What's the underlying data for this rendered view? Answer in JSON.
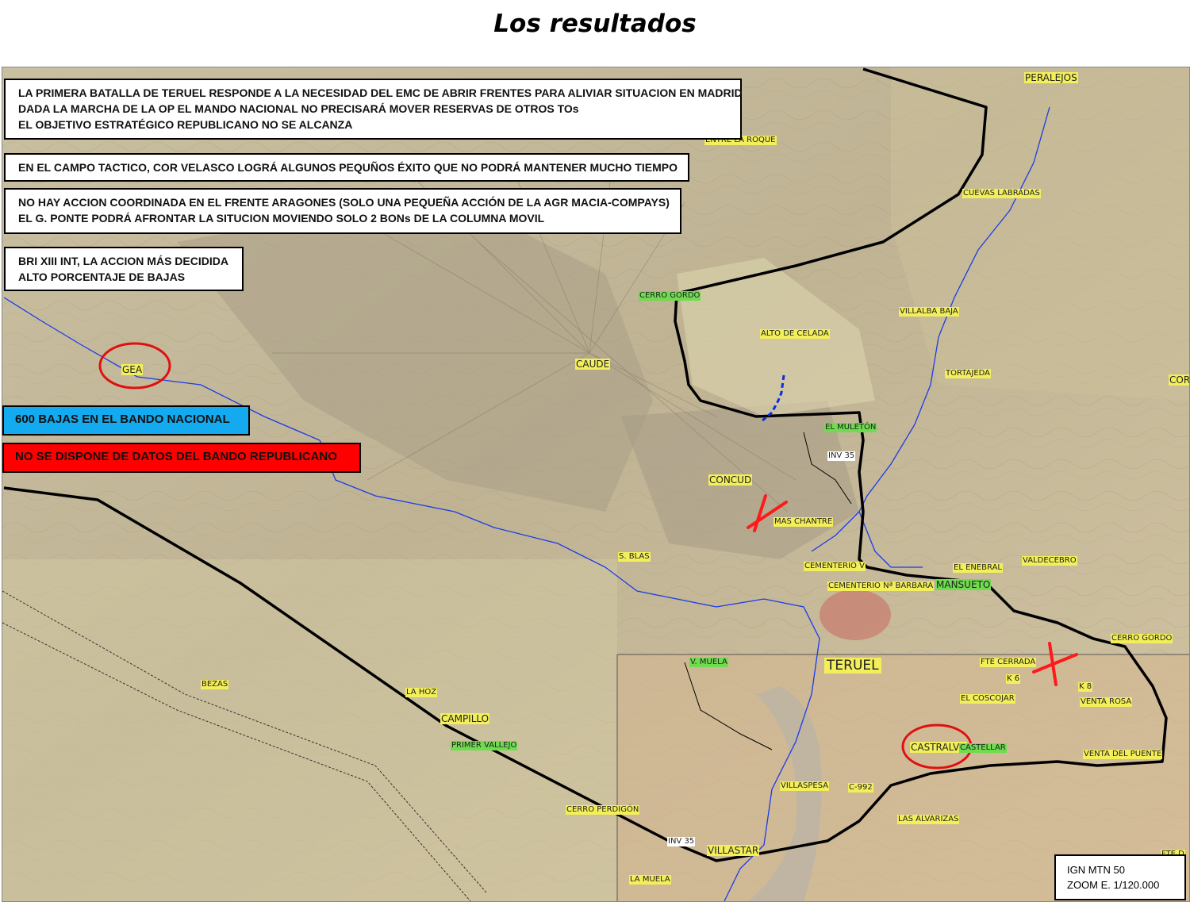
{
  "title": "Los resultados",
  "colors": {
    "nationalist_box": "#14aaf0",
    "republican_box": "#ff0000",
    "front_line": "#000000",
    "river": "#1a3ce8",
    "marker_x": "#ff1a1a",
    "circle": "#e01010",
    "label_yellow": "#f3ef5a",
    "label_green": "#6fdc4f"
  },
  "info_boxes": [
    {
      "lines": [
        "LA PRIMERA BATALLA DE TERUEL RESPONDE A LA NECESIDAD DEL EMC DE ABRIR FRENTES PARA ALIVIAR SITUACION EN MADRID",
        "DADA LA MARCHA DE LA OP EL MANDO NACIONAL NO PRECISARÁ MOVER RESERVAS DE OTROS TOs",
        "EL OBJETIVO ESTRATÉGICO REPUBLICANO NO SE ALCANZA"
      ]
    },
    {
      "lines": [
        "EN EL CAMPO TACTICO, COR VELASCO LOGRÁ ALGUNOS  PEQUÑOS ÉXITO QUE NO PODRÁ MANTENER MUCHO TIEMPO"
      ]
    },
    {
      "lines": [
        "NO HAY ACCION COORDINADA EN EL FRENTE ARAGONES (SOLO UNA PEQUEÑA ACCIÓN DE LA AGR MACIA-COMPAYS)",
        "EL G. PONTE PODRÁ AFRONTAR LA SITUCION MOVIENDO SOLO 2 BONs DE LA COLUMNA MOVIL"
      ]
    },
    {
      "lines": [
        "BRI XIII INT, LA ACCION MÁS DECIDIDA",
        "ALTO PORCENTAJE DE BAJAS"
      ]
    }
  ],
  "casualties": {
    "nationalist": "600 BAJAS EN EL BANDO NACIONAL",
    "republican": "NO SE DISPONE DE DATOS DEL BANDO REPUBLICANO"
  },
  "scale": {
    "source": "IGN MTN 50",
    "zoom": "ZOOM E. 1/120.000"
  },
  "places": [
    {
      "name": "PERALEJOS",
      "style": "yellow big"
    },
    {
      "name": "ENTRE LA ROQUE",
      "style": "yellow"
    },
    {
      "name": "CUEVAS LABRADAS",
      "style": "yellow"
    },
    {
      "name": "CERRO GORDO",
      "style": "green"
    },
    {
      "name": "VILLALBA BAJA",
      "style": "yellow"
    },
    {
      "name": "ALTO DE CELADA",
      "style": "yellow"
    },
    {
      "name": "TORTAJEDA",
      "style": "yellow"
    },
    {
      "name": "GEA",
      "style": "yellow big"
    },
    {
      "name": "CAUDE",
      "style": "yellow big"
    },
    {
      "name": "EL MULETÓN",
      "style": "green"
    },
    {
      "name": "INV 35",
      "style": "white"
    },
    {
      "name": "CONCUD",
      "style": "yellow big"
    },
    {
      "name": "MAS CHANTRE",
      "style": "yellow"
    },
    {
      "name": "S. BLAS",
      "style": "yellow"
    },
    {
      "name": "CEMENTERIO V",
      "style": "yellow"
    },
    {
      "name": "CEMENTERIO Nª BARBARA",
      "style": "yellow"
    },
    {
      "name": "MANSUETO",
      "style": "green big"
    },
    {
      "name": "EL ENEBRAL",
      "style": "yellow"
    },
    {
      "name": "VALDECEBRO",
      "style": "yellow"
    },
    {
      "name": "COR",
      "style": "yellow big"
    },
    {
      "name": "CERRO GORDO",
      "style": "yellow"
    },
    {
      "name": "V. MUELA",
      "style": "green"
    },
    {
      "name": "TERUEL",
      "style": "yellow huge"
    },
    {
      "name": "FTE CERRADA",
      "style": "yellow"
    },
    {
      "name": "K 6",
      "style": "yellow"
    },
    {
      "name": "K 8",
      "style": "yellow"
    },
    {
      "name": "EL COSCOJAR",
      "style": "yellow"
    },
    {
      "name": "VENTA ROSA",
      "style": "yellow"
    },
    {
      "name": "BEZAS",
      "style": "yellow"
    },
    {
      "name": "LA HOZ",
      "style": "yellow"
    },
    {
      "name": "CAMPILLO",
      "style": "yellow big"
    },
    {
      "name": "PRIMER VALLEJO",
      "style": "green"
    },
    {
      "name": "CASTRALVO",
      "style": "yellow big"
    },
    {
      "name": "CASTELLAR",
      "style": "green"
    },
    {
      "name": "VENTA DEL PUENTE",
      "style": "yellow"
    },
    {
      "name": "VILLASPESA",
      "style": "yellow"
    },
    {
      "name": "C-992",
      "style": "yellow"
    },
    {
      "name": "CERRO PERDIGÓN",
      "style": "yellow"
    },
    {
      "name": "LAS ALVARIZAS",
      "style": "yellow"
    },
    {
      "name": "INV 35",
      "style": "white"
    },
    {
      "name": "VILLASTAR",
      "style": "yellow big"
    },
    {
      "name": "LA MUELA",
      "style": "yellow"
    },
    {
      "name": "FTE D",
      "style": "yellow"
    }
  ]
}
